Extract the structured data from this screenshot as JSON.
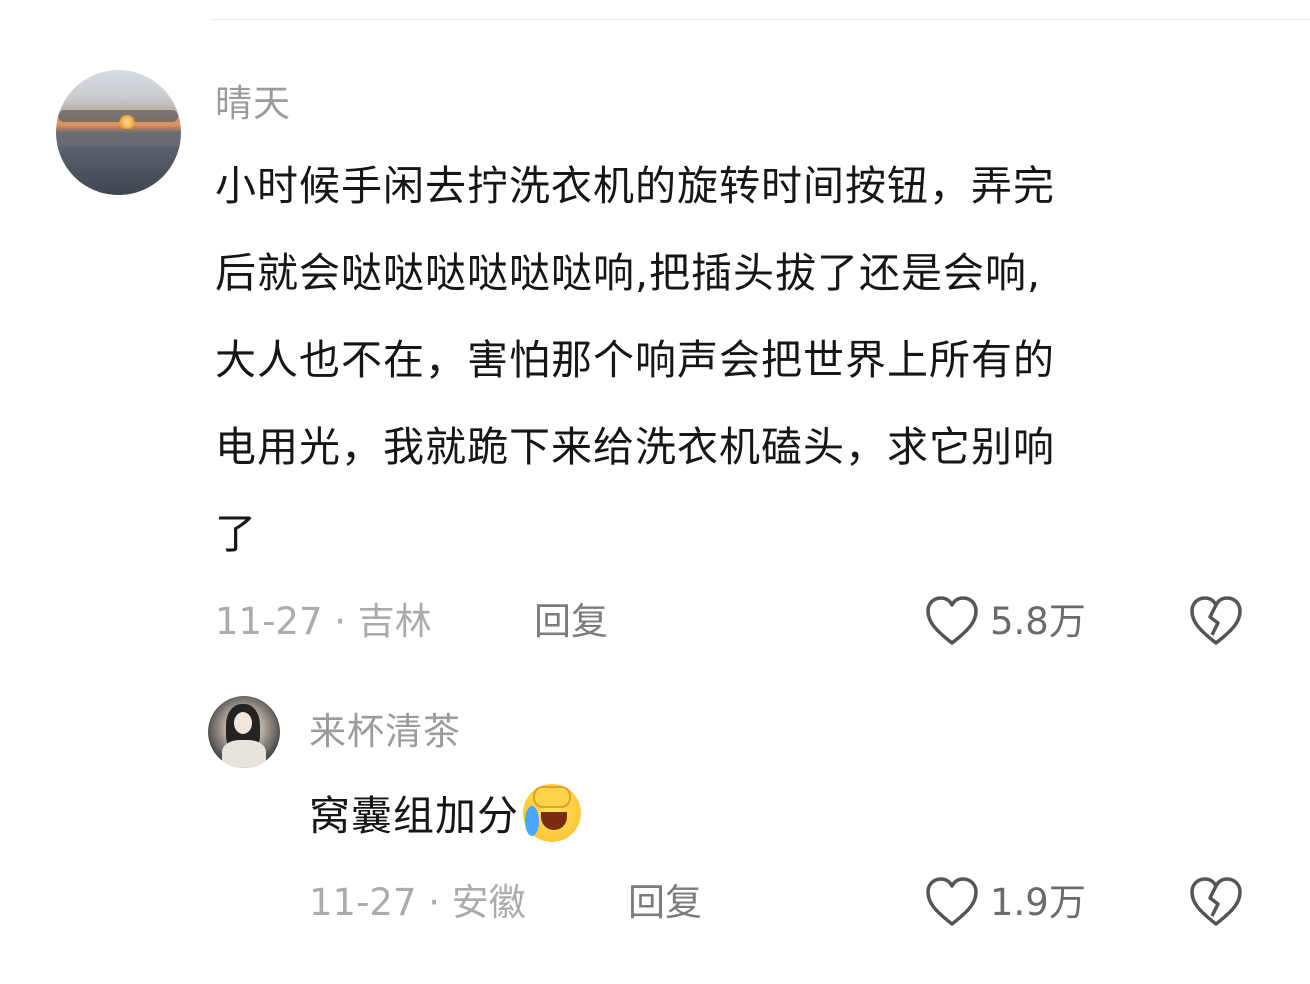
{
  "comment": {
    "username": "晴天",
    "text_lines": [
      "小时候手闲去拧洗衣机的旋转时间按钮，弄完",
      "后就会哒哒哒哒哒哒响,把插头拔了还是会响,",
      "大人也不在，害怕那个响声会把世界上所有的",
      "电用光，我就跪下来给洗衣机磕头，求它别响",
      "了"
    ],
    "date_location": "11-27 · 吉林",
    "reply_label": "回复",
    "like_count": "5.8万"
  },
  "reply": {
    "username": "来杯清茶",
    "text": "窝囊组加分",
    "emoji": "rolling-on-floor-laughing-icon",
    "date_location": "11-27 · 安徽",
    "reply_label": "回复",
    "like_count": "1.9万"
  },
  "colors": {
    "text": "#161616",
    "username": "#9b9b9b",
    "meta": "#ababab",
    "icon": "#555555"
  }
}
